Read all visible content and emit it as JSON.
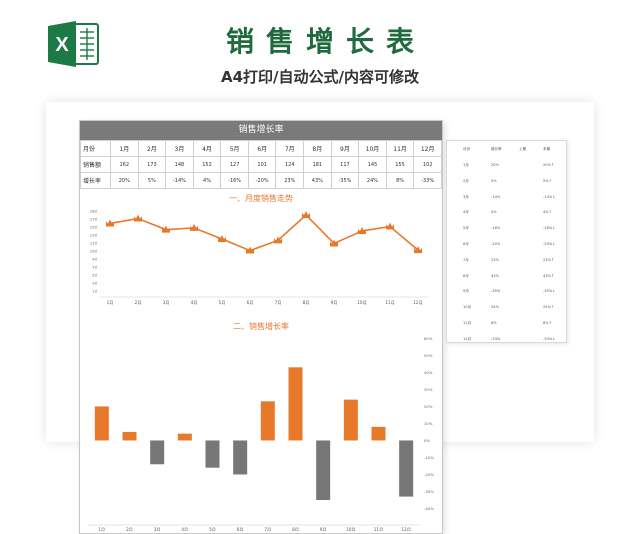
{
  "header": {
    "title": "销售增长表",
    "subtitle": "A4打印/自动公式/内容可修改",
    "icon": "excel-icon",
    "icon_letter": "X"
  },
  "colors": {
    "brand": "#1f6b3e",
    "accent": "#e8782a",
    "gray": "#777777",
    "excel": "#1d7a46"
  },
  "sheet": {
    "title": "销售增长率",
    "table": {
      "header_label": "月份",
      "months": [
        "1月",
        "2月",
        "3月",
        "4月",
        "5月",
        "6月",
        "7月",
        "8月",
        "9月",
        "10月",
        "11月",
        "12月"
      ],
      "rows": [
        {
          "label": "销售额",
          "values": [
            "162",
            "173",
            "148",
            "152",
            "127",
            "101",
            "124",
            "181",
            "117",
            "145",
            "155",
            "102"
          ]
        },
        {
          "label": "增长率",
          "values": [
            "20%",
            "5%",
            "-14%",
            "4%",
            "-16%",
            "-20%",
            "23%",
            "43%",
            "-35%",
            "24%",
            "8%",
            "-33%"
          ]
        }
      ]
    }
  },
  "chart_data": [
    {
      "type": "line",
      "title": "一、月度销售走势",
      "categories": [
        "1月",
        "2月",
        "3月",
        "4月",
        "5月",
        "6月",
        "7月",
        "8月",
        "9月",
        "10月",
        "11月",
        "12月"
      ],
      "values": [
        162,
        173,
        148,
        152,
        127,
        101,
        124,
        181,
        117,
        145,
        155,
        102
      ],
      "y_ticks": [
        "180",
        "170",
        "150",
        "130",
        "110",
        "100",
        "90",
        "70",
        "50",
        "30",
        "10"
      ],
      "ylim": [
        10,
        190
      ]
    },
    {
      "type": "bar",
      "title": "二、销售增长率",
      "categories": [
        "1月",
        "2月",
        "3月",
        "4月",
        "5月",
        "6月",
        "7月",
        "8月",
        "9月",
        "10月",
        "11月",
        "12月"
      ],
      "values": [
        20,
        5,
        -14,
        4,
        -16,
        -20,
        23,
        43,
        -35,
        24,
        8,
        -33
      ],
      "y_ticks": [
        "60%",
        "50%",
        "40%",
        "30%",
        "20%",
        "10%",
        "0%",
        "-10%",
        "-20%",
        "-30%",
        "-40%"
      ],
      "ylim": [
        -45,
        62
      ]
    }
  ],
  "side_table": {
    "headers": [
      "月份",
      "增长率",
      "上期",
      "本期"
    ],
    "rows": [
      [
        "1月",
        "20%",
        "",
        "20%↑"
      ],
      [
        "2月",
        "5%",
        "",
        "5%↑"
      ],
      [
        "3月",
        "-14%",
        "",
        "-14%↓"
      ],
      [
        "4月",
        "4%",
        "",
        "4%↑"
      ],
      [
        "5月",
        "-16%",
        "",
        "-16%↓"
      ],
      [
        "6月",
        "-20%",
        "",
        "-20%↓"
      ],
      [
        "7月",
        "23%",
        "",
        "23%↑"
      ],
      [
        "8月",
        "43%",
        "",
        "43%↑"
      ],
      [
        "9月",
        "-35%",
        "",
        "-35%↓"
      ],
      [
        "10月",
        "24%",
        "",
        "24%↑"
      ],
      [
        "11月",
        "8%",
        "",
        "8%↑"
      ],
      [
        "12月",
        "-33%",
        "",
        "-33%↓"
      ]
    ]
  }
}
